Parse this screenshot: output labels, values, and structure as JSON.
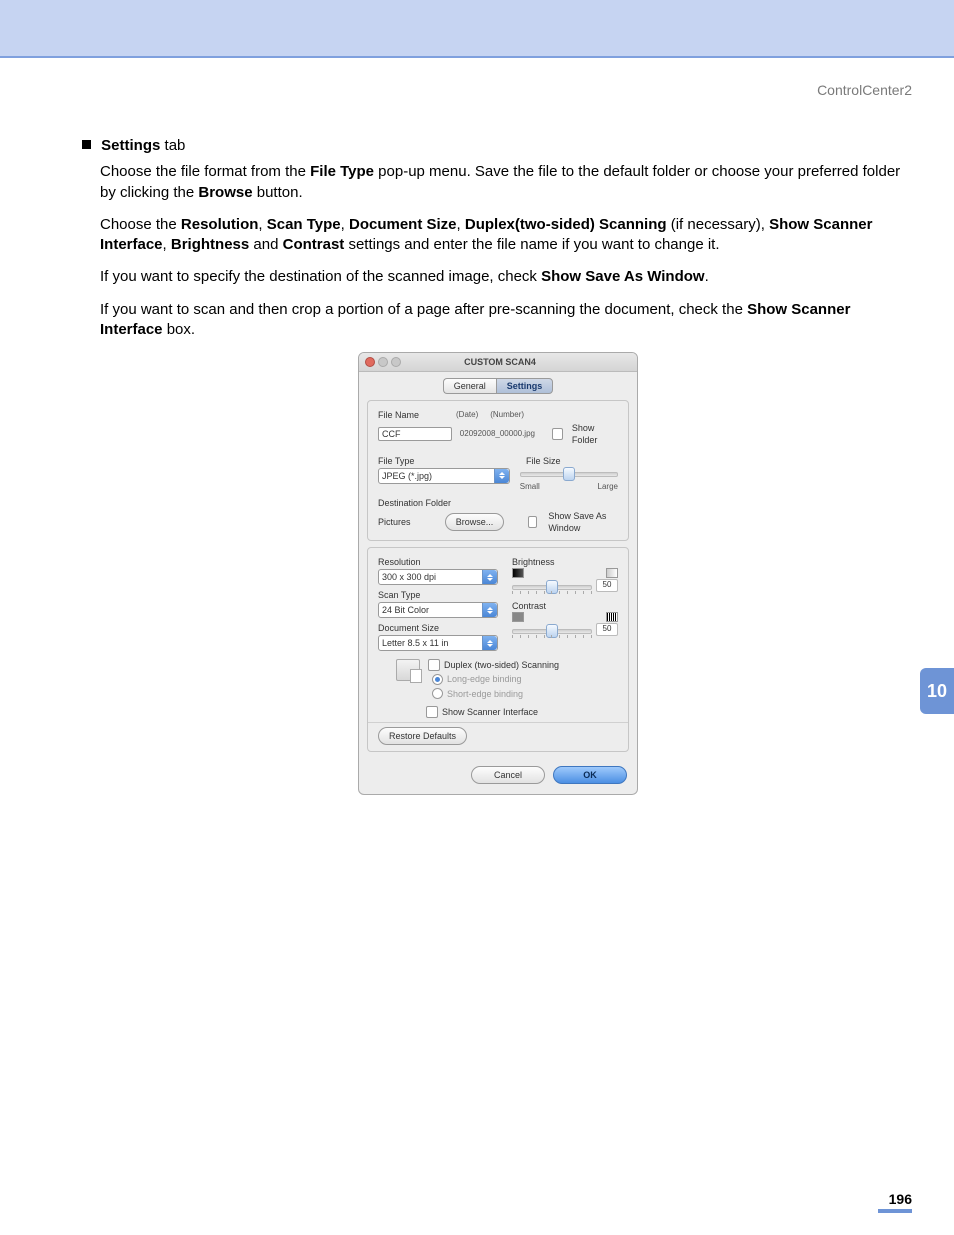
{
  "page": {
    "header": "ControlCenter2",
    "chapter_number": "10",
    "page_number": "196"
  },
  "body": {
    "heading_settings": "Settings",
    "heading_tab": " tab",
    "p1_a": "Choose the file format from the ",
    "p1_b": "File Type",
    "p1_c": " pop-up menu. Save the file to the default folder or choose your preferred folder by clicking the ",
    "p1_d": "Browse",
    "p1_e": " button.",
    "p2_a": "Choose the ",
    "p2_res": "Resolution",
    "p2_sep": ", ",
    "p2_st": "Scan Type",
    "p2_ds": "Document Size",
    "p2_dp": "Duplex(two-sided) Scanning",
    "p2_if": " (if necessary), ",
    "p2_ssi": "Show Scanner Interface",
    "p2_br": "Brightness",
    "p2_and": " and ",
    "p2_ct": "Contrast",
    "p2_end": " settings and enter the file name if you want to change it.",
    "p3_a": "If you want to specify the destination of the scanned image, check ",
    "p3_b": "Show Save As Window",
    "p3_c": ".",
    "p4_a": "If you want to scan and then crop a portion of a page after pre-scanning the document, check the ",
    "p4_b": "Show Scanner Interface",
    "p4_c": " box."
  },
  "dialog": {
    "title": "CUSTOM SCAN4",
    "tabs": {
      "general": "General",
      "settings": "Settings"
    },
    "labels": {
      "file_name": "File Name",
      "date": "(Date)",
      "number": "(Number)",
      "show_folder": "Show Folder",
      "file_type": "File Type",
      "file_size": "File Size",
      "small": "Small",
      "large": "Large",
      "dest_folder": "Destination Folder",
      "browse": "Browse...",
      "show_save_as": "Show Save As Window",
      "resolution": "Resolution",
      "scan_type": "Scan Type",
      "document_size": "Document Size",
      "brightness": "Brightness",
      "contrast": "Contrast",
      "duplex": "Duplex (two-sided) Scanning",
      "long_edge": "Long-edge binding",
      "short_edge": "Short-edge binding",
      "show_scanner_if": "Show Scanner Interface",
      "restore": "Restore Defaults",
      "cancel": "Cancel",
      "ok": "OK"
    },
    "values": {
      "file_name": "CCF",
      "date_number": "02092008_00000.jpg",
      "file_type": "JPEG (*.jpg)",
      "dest_folder": "Pictures",
      "resolution": "300 x 300 dpi",
      "scan_type": "24 Bit Color",
      "document_size": "Letter  8.5 x 11 in",
      "brightness": "50",
      "contrast": "50"
    }
  }
}
